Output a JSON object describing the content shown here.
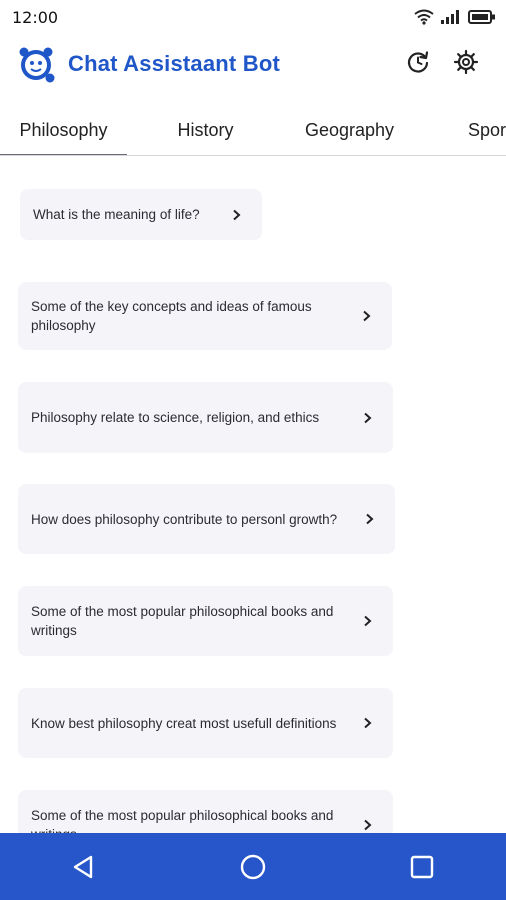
{
  "status": {
    "time": "12:00"
  },
  "app": {
    "title": "Chat Assistaant Bot"
  },
  "icons": {
    "logo": "robot-icon",
    "refresh": "refresh-icon",
    "settings": "gear-icon",
    "chevron": "chevron-right-icon",
    "nav_back": "triangle-back-icon",
    "nav_home": "circle-home-icon",
    "nav_recents": "square-recents-icon"
  },
  "colors": {
    "brand": "#1f56c8",
    "card": "#f4f4f9",
    "nav": "#2656c9"
  },
  "tabs": [
    {
      "label": "Philosophy",
      "active": true
    },
    {
      "label": "History"
    },
    {
      "label": "Geography"
    },
    {
      "label": "Spor"
    }
  ],
  "questions": [
    {
      "text": "What is the meaning of life?"
    },
    {
      "text": "Some of the key concepts and ideas of famous philosophy"
    },
    {
      "text": "Philosophy relate to science, religion, and ethics"
    },
    {
      "text": "How does philosophy contribute to personl growth?"
    },
    {
      "text": "Some of the most popular philosophical books and writings"
    },
    {
      "text": "Know best philosophy creat most usefull definitions"
    },
    {
      "text": "Some of the most popular philosophical books and writings"
    }
  ]
}
